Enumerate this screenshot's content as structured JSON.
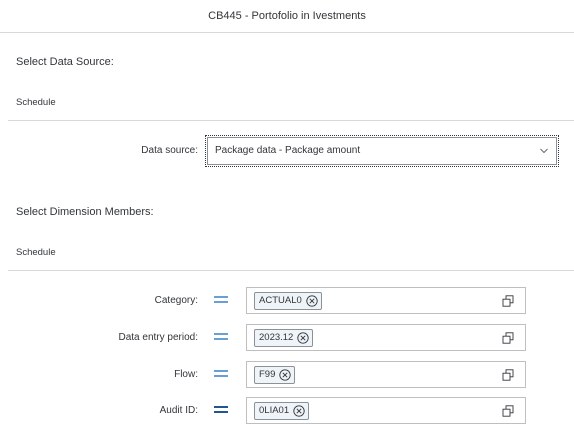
{
  "dialog": {
    "title": "CB445 - Portofolio in Ivestments"
  },
  "data_source_section": {
    "heading": "Select Data Source:",
    "subheader": "Schedule",
    "label": "Data source:",
    "selected_value": "Package data - Package amount",
    "icon": "chevron-down-icon"
  },
  "dimension_section": {
    "heading": "Select Dimension Members:",
    "subheader": "Schedule",
    "rows": [
      {
        "label": "Category:",
        "operator": "equals-icon",
        "token": "ACTUAL0",
        "value_help": "value-help-icon"
      },
      {
        "label": "Data entry period:",
        "operator": "equals-icon",
        "token": "2023.12",
        "value_help": "value-help-icon"
      },
      {
        "label": "Flow:",
        "operator": "equals-icon",
        "token": "F99",
        "value_help": "value-help-icon"
      },
      {
        "label": "Audit ID:",
        "operator": "equals-icon",
        "token": "0LIA01",
        "value_help": "value-help-icon"
      }
    ]
  },
  "colors": {
    "operator": "#6a9fd4",
    "operator_active": "#23568c",
    "token_bg": "#eff4f9",
    "border": "#bfbfbf"
  }
}
